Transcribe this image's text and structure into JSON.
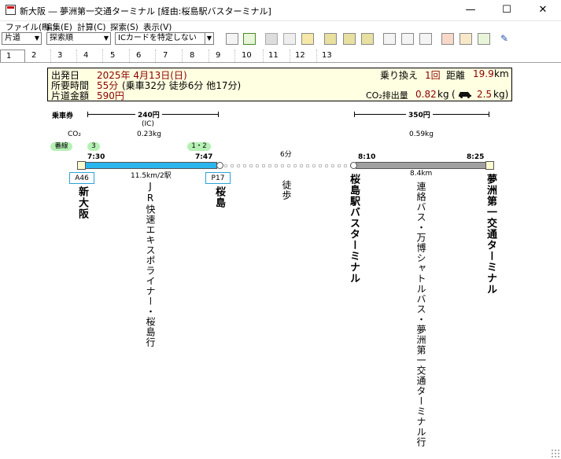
{
  "window": {
    "title": "新大阪 ― 夢洲第一交通ターミナル [経由:桜島駅バスターミナル]",
    "minimize": "—",
    "maximize": "☐",
    "close": "✕"
  },
  "menu": [
    "ファイル(F)",
    "編集(E)",
    "計算(C)",
    "探索(S)",
    "表示(V)"
  ],
  "toolbar": {
    "trip_type": "片道",
    "sort_order": "探索順",
    "ic_card": "ICカードを特定しない"
  },
  "tabs": [
    "1",
    "2",
    "3",
    "4",
    "5",
    "6",
    "7",
    "8",
    "9",
    "10",
    "11",
    "12",
    "13"
  ],
  "summary": {
    "departure_label": "出発日",
    "departure_value": "2025年 4月13日(日)",
    "duration_label": "所要時間",
    "duration_value": "55分",
    "duration_detail": "(乗車32分 徒歩6分 他17分)",
    "fare_label": "片道金額",
    "fare_value": "590円",
    "transfers_label": "乗り換え",
    "transfers_value": "1回",
    "distance_label": "距離",
    "distance_value": "19.9",
    "distance_unit": "km",
    "co2_label": "CO₂排出量",
    "co2_value": "0.82",
    "co2_unit": "kg",
    "car_co2_open": "(",
    "car_co2_value": "2.5",
    "car_co2_unit": "kg)"
  },
  "route": {
    "ticket_label": "乗車券",
    "co2_label": "CO₂",
    "track_label": "番線",
    "seg1_fare": "240円",
    "seg1_ic": "(IC)",
    "seg1_co2": "0.23kg",
    "seg2_fare": "350円",
    "seg2_co2": "0.59kg",
    "track_dep": "3",
    "track_arr": "1・2",
    "time_1": "7:30",
    "time_2": "7:47",
    "time_3": "8:10",
    "time_4": "8:25",
    "walk_time": "6分",
    "seg1_distance": "11.5km/2駅",
    "seg2_distance": "8.4km",
    "platform_1": "A46",
    "platform_2": "P17",
    "station_1": "新大阪",
    "station_2": "桜島",
    "station_3": "桜島駅バスターミナル",
    "station_4": "夢洲第一交通ターミナル",
    "line_1": "JR快速エキスポライナー・桜島行",
    "walk_label": "徒歩",
    "line_2": "連絡バス・万博シャトルバス・夢洲第一交通ターミナル行"
  },
  "colors": {
    "train_line": "#2bb5ee",
    "bus_line": "#a0a0a0",
    "summary_bg": "#ffffe1",
    "value_text": "#8b0000",
    "track_badge": "#b5f0b5"
  }
}
